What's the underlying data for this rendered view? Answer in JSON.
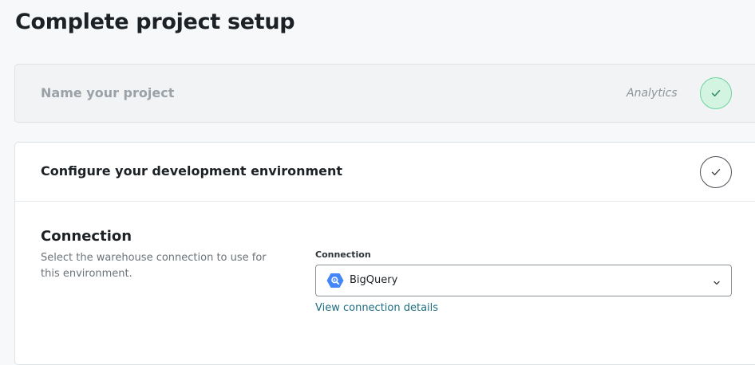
{
  "page": {
    "title": "Complete project setup"
  },
  "steps": [
    {
      "title": "Name your project",
      "value": "Analytics",
      "status": "complete",
      "icon": "check-icon"
    },
    {
      "title": "Configure your development environment",
      "status": "in-progress",
      "icon": "check-icon"
    }
  ],
  "connection_section": {
    "title": "Connection",
    "description": "Select the warehouse connection to use for this environment.",
    "field_label": "Connection",
    "selected_value": "BigQuery",
    "selected_icon": "bigquery-icon",
    "dropdown_icon": "chevron-down-icon",
    "link_text": "View connection details"
  },
  "colors": {
    "complete_fill": "#d4f4e2",
    "complete_border": "#6fd39f",
    "link": "#1f6e80",
    "bigquery_blue": "#4386fa"
  }
}
